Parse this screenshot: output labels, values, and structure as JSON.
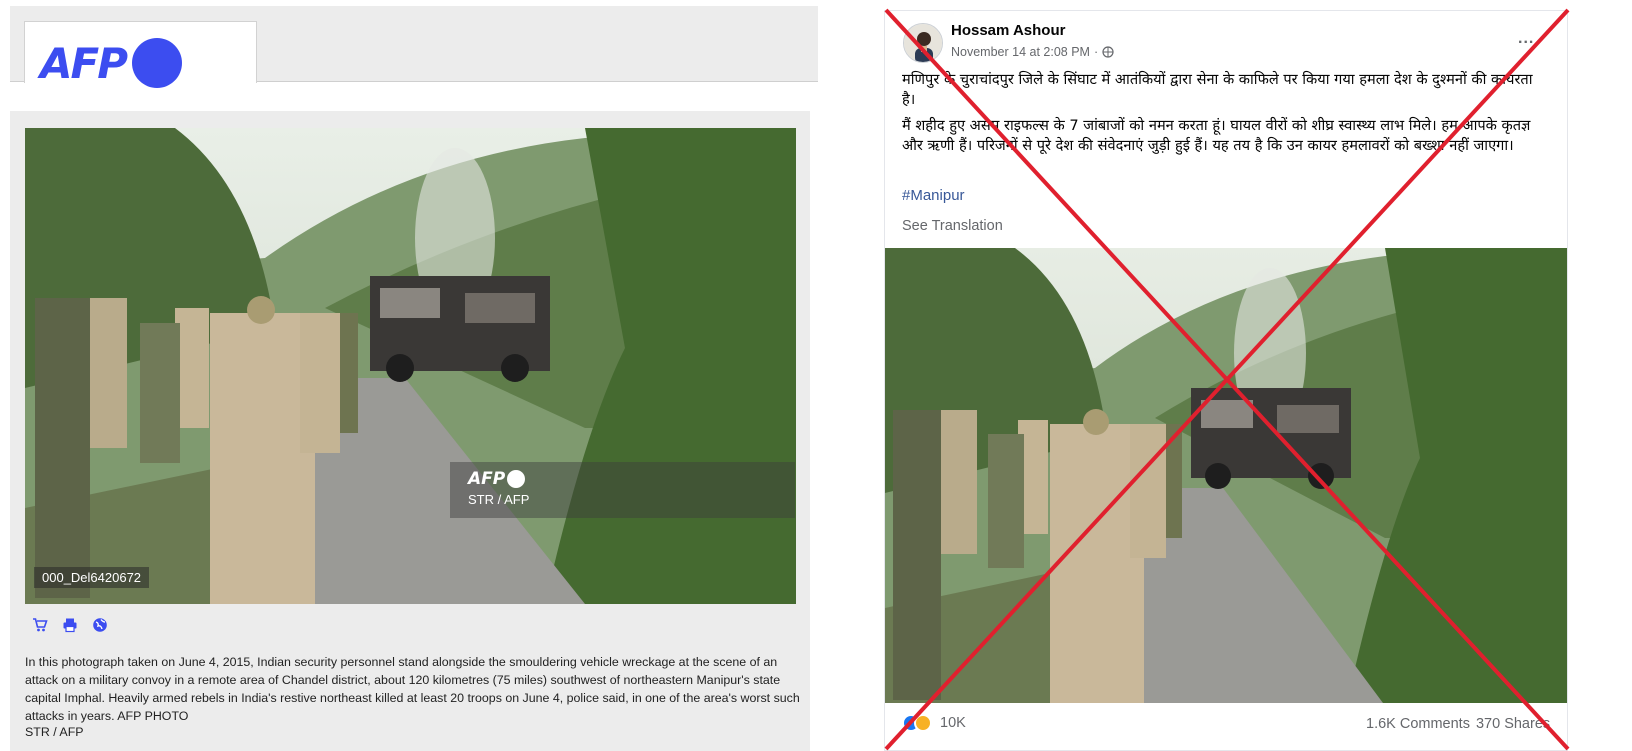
{
  "afp": {
    "logo_text": "AFP",
    "watermark_logo_text": "AFP",
    "watermark_credit": "STR / AFP",
    "image_id": "000_Del6420672",
    "icons": [
      "cart-icon",
      "print-icon",
      "globe-icon"
    ],
    "caption": "In this photograph taken on June 4, 2015, Indian security personnel stand alongside the smouldering vehicle wreckage at the scene of an attack on a military convoy in a remote area of Chandel district, about 120 kilometres (75 miles) southwest of northeastern Manipur's state capital Imphal. Heavily armed rebels in India's restive northeast killed at least 20 troops on June 4, police said, in one of the area's worst such attacks in years. AFP PHOTO",
    "credit": "STR / AFP",
    "brand_color": "#3c4df0"
  },
  "facebook_post": {
    "author": "Hossam Ashour",
    "timestamp": "November 14 at 2:08 PM",
    "separator": "·",
    "privacy_icon": "globe-icon",
    "more_menu": "...",
    "paragraph_1": "मणिपुर के चुराचांदपुर जिले के सिंघाट में आतंकियों द्वारा सेना के काफिले पर किया गया हमला देश के दुश्मनों की कायरता है।",
    "paragraph_2": "मैं शहीद हुए असम राइफल्स के 7 जांबाजों को नमन करता हूं। घायल वीरों को शीघ्र स्वास्थ्य लाभ मिले। हम आपके कृतज्ञ और ऋणी हैं। परिजनों से पूरे देश की संवेदनाएं जुड़ी हुई हैं। यह तय है कि उन कायर हमलावरों को बख्शा नहीं जाएगा।",
    "hashtag": "#Manipur",
    "see_translation": "See Translation",
    "reactions": [
      "like",
      "sad"
    ],
    "reaction_count": "10K",
    "comments": "1.6K Comments",
    "shares": "370 Shares",
    "link_color": "#385898",
    "cross_color": "#e0202e"
  }
}
